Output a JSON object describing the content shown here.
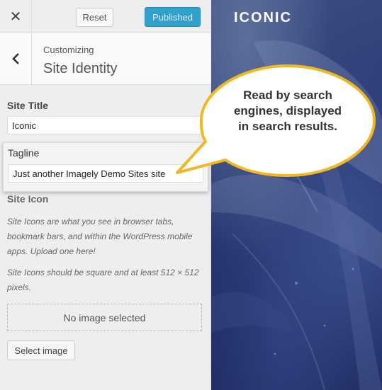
{
  "topbar": {
    "close_icon": "close-icon",
    "reset_label": "Reset",
    "publish_label": "Published",
    "publish_color": "#2ea2cc"
  },
  "section": {
    "back_icon": "chevron-left-icon",
    "breadcrumb": "Customizing",
    "title": "Site Identity"
  },
  "site_title": {
    "label": "Site Title",
    "value": "Iconic"
  },
  "tagline": {
    "label": "Tagline",
    "value": "Just another Imagely Demo Sites site"
  },
  "site_icon": {
    "label": "Site Icon",
    "description_1": "Site Icons are what you see in browser tabs, bookmark bars, and within the WordPress mobile apps. Upload one here!",
    "description_2": "Site Icons should be square and at least 512 × 512 pixels.",
    "placeholder": "No image selected",
    "select_label": "Select image"
  },
  "preview": {
    "logo": "ICONIC"
  },
  "callout": {
    "text": "Read by search engines, displayed in search results.",
    "border_color": "#f2b824"
  }
}
